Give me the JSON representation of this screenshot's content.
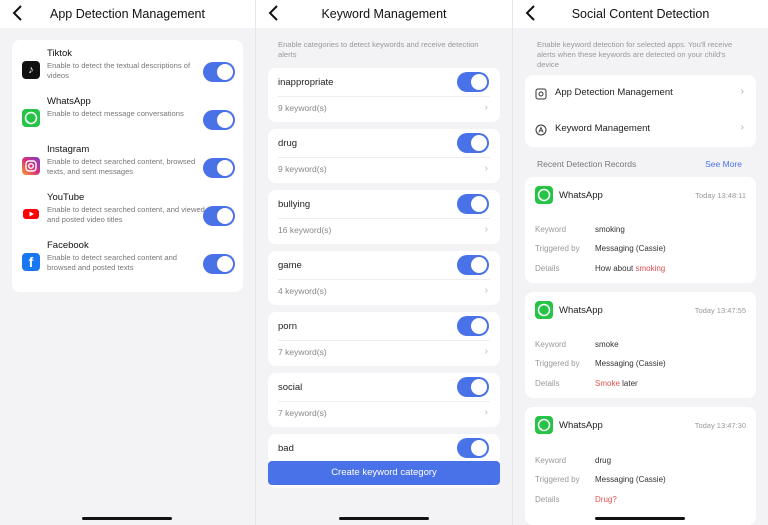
{
  "app_detection": {
    "title": "App Detection Management",
    "apps": [
      {
        "name": "Tiktok",
        "desc": "Enable to detect the textual descriptions of videos",
        "icon": "tiktok-icon",
        "color": "#111111"
      },
      {
        "name": "WhatsApp",
        "desc": "Enable to detect message conversations",
        "icon": "whatsapp-icon",
        "color": "#25c447"
      },
      {
        "name": "Instagram",
        "desc": "Enable to detect searched content, browsed texts, and sent messages",
        "icon": "instagram-icon",
        "color": "#d6307a"
      },
      {
        "name": "YouTube",
        "desc": "Enable to detect searched content, and viewed and posted video titles",
        "icon": "youtube-icon",
        "color": "#ff0000"
      },
      {
        "name": "Facebook",
        "desc": "Enable to detect searched content and browsed and posted texts",
        "icon": "facebook-icon",
        "color": "#1877f2"
      }
    ]
  },
  "keyword_management": {
    "title": "Keyword Management",
    "hint": "Enable categories to detect keywords and receive detection alerts",
    "categories": [
      {
        "name": "inappropriate",
        "count": "9 keyword(s)"
      },
      {
        "name": "drug",
        "count": "9 keyword(s)"
      },
      {
        "name": "bullying",
        "count": "16 keyword(s)"
      },
      {
        "name": "game",
        "count": "4 keyword(s)"
      },
      {
        "name": "porn",
        "count": "7 keyword(s)"
      },
      {
        "name": "social",
        "count": "7 keyword(s)"
      },
      {
        "name": "bad",
        "count": ""
      }
    ],
    "create_button": "Create keyword category"
  },
  "social_content": {
    "title": "Social Content Detection",
    "hint": "Enable keyword detection for selected apps. You'll receive alerts when these keywords are detected on your child's device",
    "menu": [
      {
        "label": "App Detection Management",
        "icon": "gear-icon"
      },
      {
        "label": "Keyword Management",
        "icon": "keyword-icon"
      }
    ],
    "records_title": "Recent Detection Records",
    "see_more": "See More",
    "labels": {
      "keyword": "Keyword",
      "triggered_by": "Triggered by",
      "details": "Details"
    },
    "records": [
      {
        "app": "WhatsApp",
        "time": "Today 13:48:11",
        "keyword": "smoking",
        "triggered_by": "Messaging (Cassie)",
        "details_prefix": "How about ",
        "details_highlight": "smoking",
        "details_suffix": ""
      },
      {
        "app": "WhatsApp",
        "time": "Today 13:47:55",
        "keyword": "smoke",
        "triggered_by": "Messaging (Cassie)",
        "details_prefix": "",
        "details_highlight": "Smoke",
        "details_suffix": " later"
      },
      {
        "app": "WhatsApp",
        "time": "Today 13:47:30",
        "keyword": "drug",
        "triggered_by": "Messaging (Cassie)",
        "details_prefix": "",
        "details_highlight": "Drug?",
        "details_suffix": ""
      }
    ]
  },
  "colors": {
    "accent": "#4a72e8",
    "highlight": "#e2504f",
    "whatsapp": "#25c447"
  }
}
